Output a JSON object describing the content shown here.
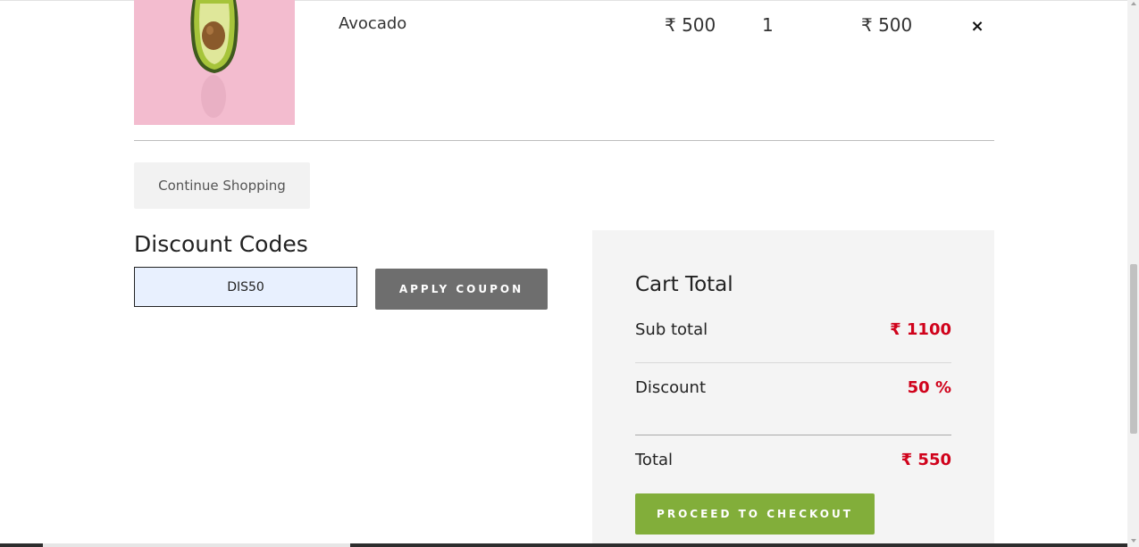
{
  "cart_item": {
    "name": "Avocado",
    "price": "₹ 500",
    "quantity": "1",
    "total": "₹ 500",
    "remove_icon": "×",
    "image": "avocado-on-pink-photo"
  },
  "actions": {
    "continue_shopping": "Continue Shopping"
  },
  "discount": {
    "title": "Discount Codes",
    "coupon_value": "DIS50",
    "apply_label": "APPLY COUPON"
  },
  "totals": {
    "title": "Cart Total",
    "subtotal_label": "Sub total",
    "subtotal_value": "₹ 1100",
    "discount_label": "Discount",
    "discount_value": "50 %",
    "total_label": "Total",
    "total_value": "₹ 550",
    "checkout_label": "PROCEED TO CHECKOUT"
  },
  "colors": {
    "accent_green": "#82ae3a",
    "value_red": "#d0021b",
    "button_gray": "#6e6e6e",
    "panel_bg": "#f4f4f4"
  }
}
